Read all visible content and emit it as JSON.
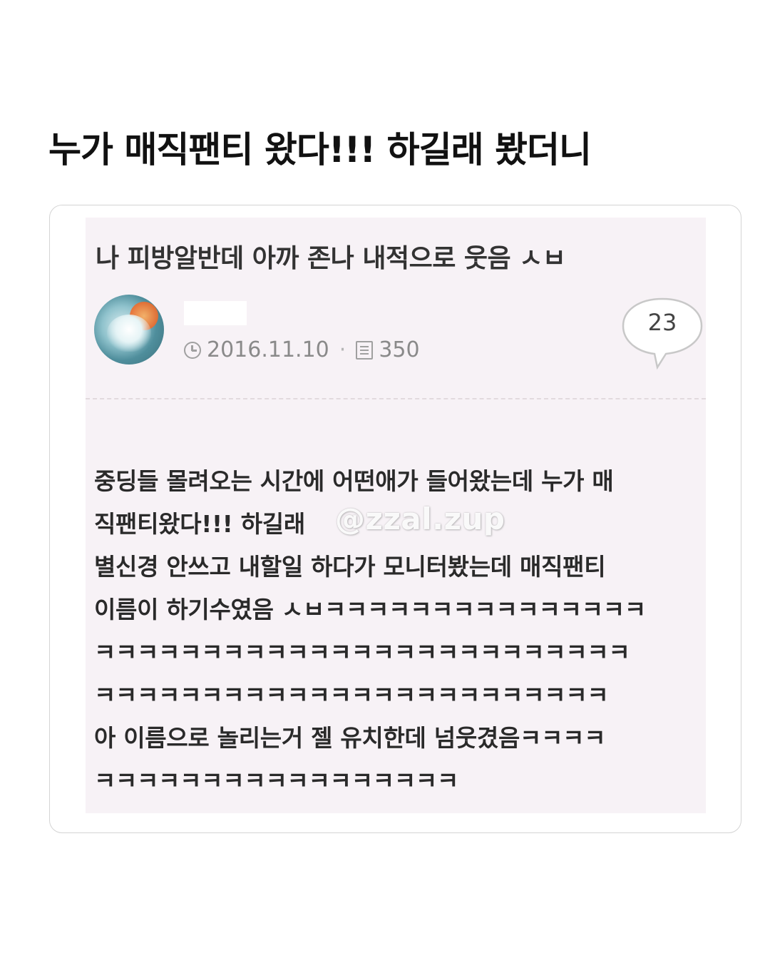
{
  "headline": "누가 매직팬티 왔다!!! 하길래 봤더니",
  "post": {
    "title": "나 피방알반데 아까 존나 내적으로 웃음 ㅅㅂ",
    "date": "2016.11.10",
    "separator": "·",
    "views": "350",
    "comment_count": "23",
    "body_lines": [
      "중딩들 몰려오는 시간에 어떤애가 들어왔는데 누가 매",
      "직팬티왔다!!! 하길래",
      "별신경 안쓰고 내할일 하다가 모니터봤는데 매직팬티",
      "이름이 하기수였음 ㅅㅂㅋㅋㅋㅋㅋㅋㅋㅋㅋㅋㅋㅋㅋㅋㅋ",
      "ㅋㅋㅋㅋㅋㅋㅋㅋㅋㅋㅋㅋㅋㅋㅋㅋㅋㅋㅋㅋㅋㅋㅋㅋㅋ",
      "ㅋㅋㅋㅋㅋㅋㅋㅋㅋㅋㅋㅋㅋㅋㅋㅋㅋㅋㅋㅋㅋㅋㅋㅋ",
      "아 이름으로 놀리는거 젤 유치한데 넘웃겼음ㅋㅋㅋㅋ",
      "ㅋㅋㅋㅋㅋㅋㅋㅋㅋㅋㅋㅋㅋㅋㅋㅋㅋ"
    ]
  },
  "watermark": "@zzal.zup",
  "icons": {
    "date": "clock-icon",
    "views": "document-icon",
    "comments": "speech-bubble-icon"
  },
  "colors": {
    "screenshot_bg": "#f7f2f6",
    "meta_text": "#8a8a8a",
    "card_border": "#d4d4d4"
  }
}
